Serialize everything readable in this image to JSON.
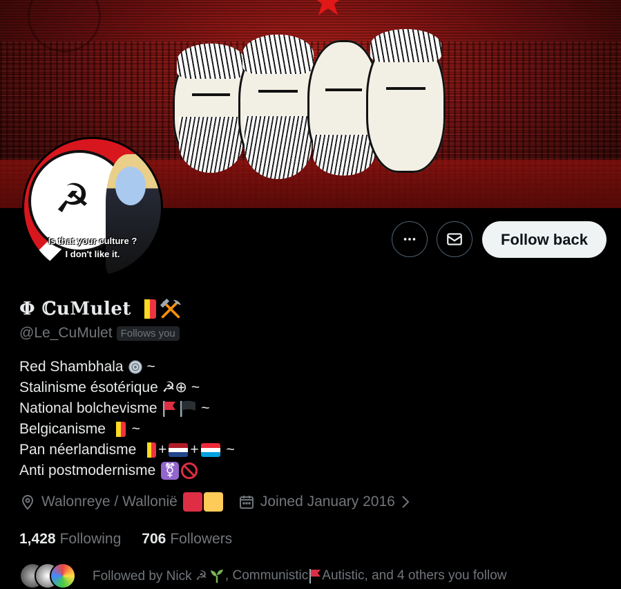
{
  "avatar": {
    "caption_line1": "Is that your culture ?",
    "caption_line2": "I don't like it."
  },
  "actions": {
    "more_icon": "more-horizontal-icon",
    "message_icon": "envelope-icon",
    "follow_back_label": "Follow back"
  },
  "profile": {
    "display_name": "Φ ℂuMulet",
    "handle": "@Le_CuMulet",
    "follows_you_badge": "Follows you"
  },
  "bio": {
    "line1": "Red Shambhala",
    "line1_tail": " ~",
    "line2": "Stalinisme ésotérique ☭⊕",
    "line2_tail": " ~",
    "line3": "National bolchevisme ",
    "line3_tail": " ~",
    "line4": "Belgicanisme ",
    "line4_tail": " ~",
    "line5": "Pan néerlandisme ",
    "plus": "+",
    "line5_tail": " ~",
    "line6": "Anti postmodernisme "
  },
  "meta": {
    "location": "Walonreye / Wallonië",
    "joined": "Joined January 2016"
  },
  "stats": {
    "following_count": "1,428",
    "following_label": "Following",
    "followers_count": "706",
    "followers_label": "Followers"
  },
  "followed_by": {
    "text_a": "Followed by Nick ☭",
    "text_b": ", Communistic ",
    "text_c": "Autistic, and 4 others you follow"
  },
  "colors": {
    "belgium_black": "#000000",
    "belgium_yellow": "#fdda24",
    "belgium_red": "#ef3340",
    "wallonia_red": "#dd2e44",
    "wallonia_yellow": "#fdcb58",
    "button_bg": "#eff3f4"
  }
}
